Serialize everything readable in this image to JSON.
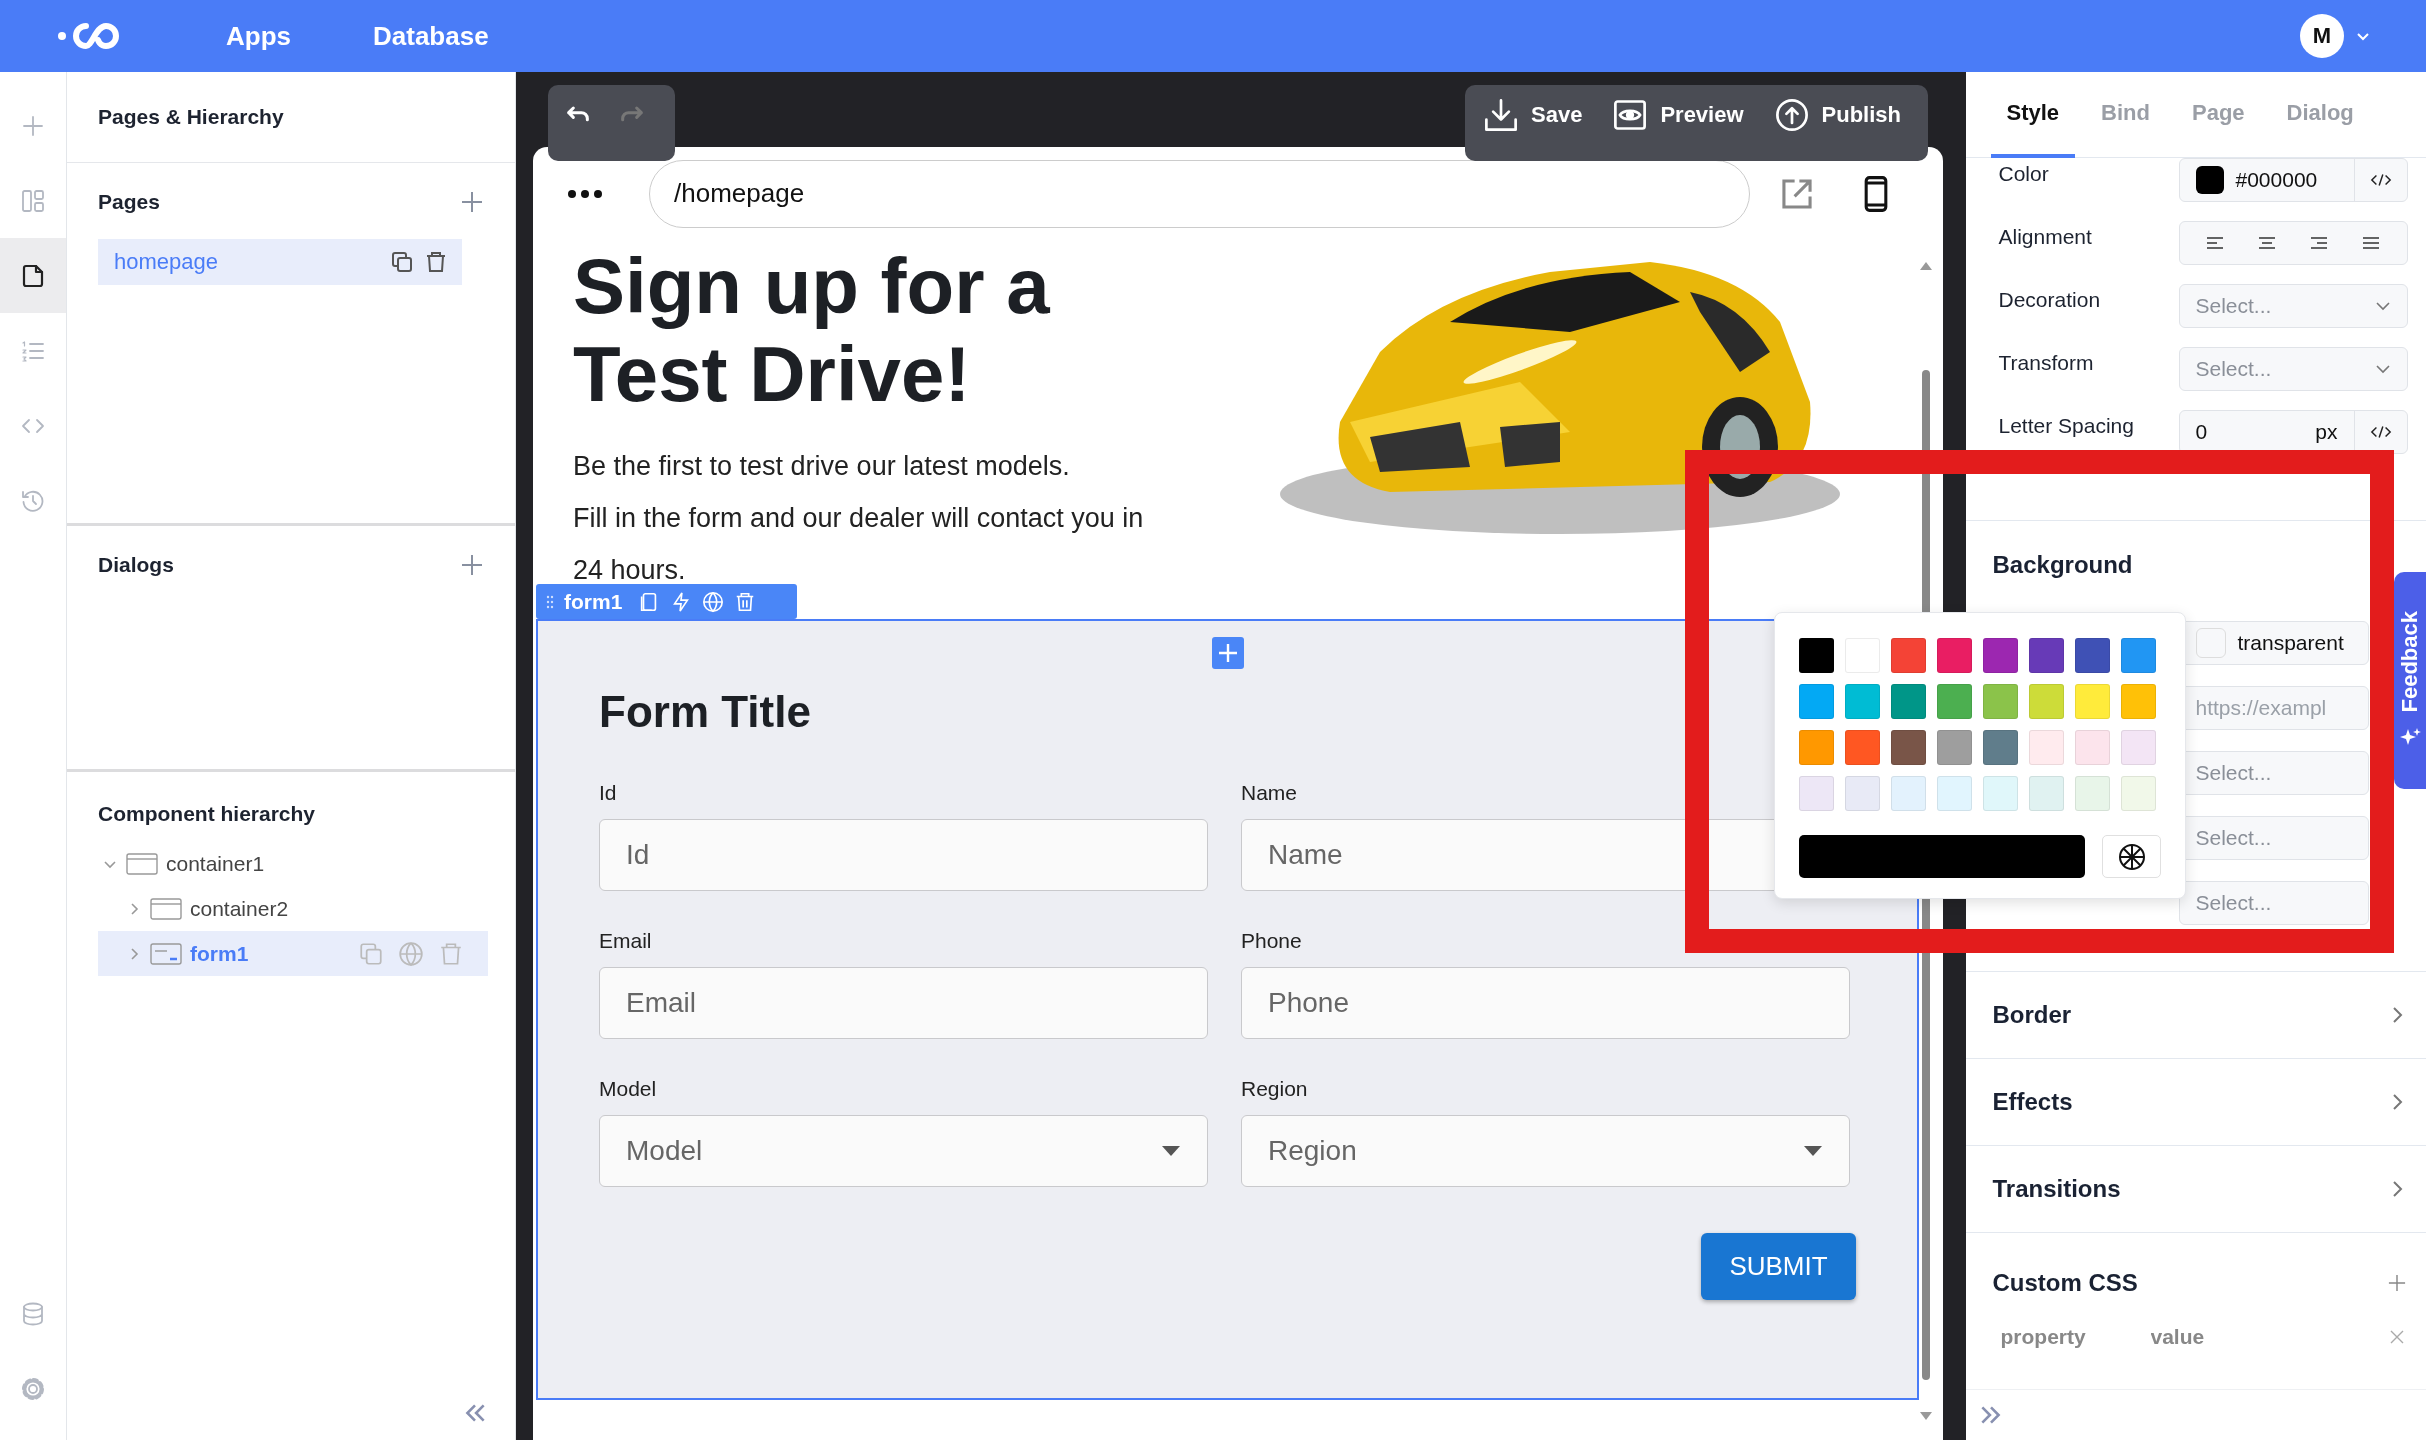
{
  "top_bar": {
    "nav": [
      {
        "label": "Apps"
      },
      {
        "label": "Database"
      }
    ],
    "avatar": "M"
  },
  "icon_rail": {
    "top": [
      {
        "kind": "add",
        "selected": false
      },
      {
        "kind": "layout",
        "selected": false
      },
      {
        "kind": "page",
        "selected": true
      },
      {
        "kind": "list",
        "selected": false
      },
      {
        "kind": "code",
        "selected": false
      },
      {
        "kind": "history",
        "selected": false
      }
    ],
    "bottom": [
      {
        "kind": "database",
        "selected": false
      },
      {
        "kind": "settings",
        "selected": false
      }
    ]
  },
  "left_panel": {
    "title": "Pages & Hierarchy",
    "pages": {
      "heading": "Pages",
      "items": [
        {
          "label": "homepage",
          "selected": true
        }
      ]
    },
    "dialogs": {
      "heading": "Dialogs"
    },
    "hierarchy": {
      "heading": "Component hierarchy",
      "items": [
        {
          "label": "container1",
          "kind": "container",
          "expanded": true,
          "selected": false,
          "children": [
            {
              "label": "container2",
              "kind": "container",
              "expanded": false,
              "selected": false
            },
            {
              "label": "form1",
              "kind": "form",
              "expanded": false,
              "selected": true
            }
          ]
        }
      ]
    }
  },
  "canvas": {
    "history": [
      {
        "kind": "undo",
        "disabled": false
      },
      {
        "kind": "redo",
        "disabled": true
      }
    ],
    "actions": [
      {
        "kind": "save",
        "label": "Save"
      },
      {
        "kind": "preview",
        "label": "Preview"
      },
      {
        "kind": "publish",
        "label": "Publish"
      }
    ],
    "url": "/homepage",
    "hero": {
      "heading": [
        "Sign up for a",
        "Test Drive!"
      ],
      "paragraphs": [
        "Be the first to test drive our latest models.",
        "Fill in the form and our dealer will contact you in 24 hours."
      ]
    },
    "selection": {
      "label": "form1"
    },
    "form": {
      "title": "Form Title",
      "fields": [
        {
          "label": "Id",
          "placeholder": "Id",
          "kind": "text"
        },
        {
          "label": "Name",
          "placeholder": "Name",
          "kind": "text"
        },
        {
          "label": "Email",
          "placeholder": "Email",
          "kind": "text"
        },
        {
          "label": "Phone",
          "placeholder": "Phone",
          "kind": "text"
        },
        {
          "label": "Model",
          "placeholder": "Model",
          "kind": "select"
        },
        {
          "label": "Region",
          "placeholder": "Region",
          "kind": "select"
        }
      ],
      "submit": "SUBMIT"
    }
  },
  "properties": {
    "tabs": [
      {
        "label": "Style",
        "selected": true
      },
      {
        "label": "Bind",
        "selected": false
      },
      {
        "label": "Page",
        "selected": false
      },
      {
        "label": "Dialog",
        "selected": false
      }
    ],
    "typography": [
      {
        "label": "Color",
        "kind": "color",
        "value": "#000000"
      },
      {
        "label": "Alignment",
        "kind": "align"
      },
      {
        "label": "Decoration",
        "kind": "select",
        "placeholder": "Select..."
      },
      {
        "label": "Transform",
        "kind": "select",
        "placeholder": "Select..."
      },
      {
        "label": "Letter Spacing",
        "kind": "number",
        "value": "0",
        "unit": "px"
      }
    ],
    "background": {
      "heading": "Background",
      "rows": [
        {
          "kind": "color",
          "value": "transparent"
        },
        {
          "kind": "text",
          "placeholder": "https://exampl"
        },
        {
          "kind": "select",
          "placeholder": "Select..."
        },
        {
          "kind": "select",
          "placeholder": "Select..."
        },
        {
          "kind": "select",
          "placeholder": "Select..."
        }
      ]
    },
    "sections": [
      {
        "label": "Border"
      },
      {
        "label": "Effects"
      },
      {
        "label": "Transitions"
      }
    ],
    "custom_css": {
      "heading": "Custom CSS",
      "property_placeholder": "property",
      "value_placeholder": "value"
    }
  },
  "color_picker": {
    "swatches": [
      {
        "color": "#000000"
      },
      {
        "color": "#ffffff"
      },
      {
        "color": "#f44336"
      },
      {
        "color": "#e91e63"
      },
      {
        "color": "#9c27b0"
      },
      {
        "color": "#673ab7"
      },
      {
        "color": "#3f51b5"
      },
      {
        "color": "#2196f3"
      },
      {
        "color": "#03a9f4"
      },
      {
        "color": "#00bcd4"
      },
      {
        "color": "#009688"
      },
      {
        "color": "#4caf50"
      },
      {
        "color": "#8bc34a"
      },
      {
        "color": "#cddc39"
      },
      {
        "color": "#ffeb3b"
      },
      {
        "color": "#ffc107"
      },
      {
        "color": "#ff9800"
      },
      {
        "color": "#ff5722"
      },
      {
        "color": "#795548"
      },
      {
        "color": "#9e9e9e"
      },
      {
        "color": "#607d8b"
      },
      {
        "color": "#ffebee"
      },
      {
        "color": "#fce4ec"
      },
      {
        "color": "#f3e5f5"
      },
      {
        "color": "#ede7f6"
      },
      {
        "color": "#e8eaf6"
      },
      {
        "color": "#e3f2fd"
      },
      {
        "color": "#e1f5fe"
      },
      {
        "color": "#e0f7fa"
      },
      {
        "color": "#e0f2f1"
      },
      {
        "color": "#e8f5e9"
      },
      {
        "color": "#f1f8e9"
      }
    ]
  },
  "feedback": {
    "label": "Feedback"
  }
}
